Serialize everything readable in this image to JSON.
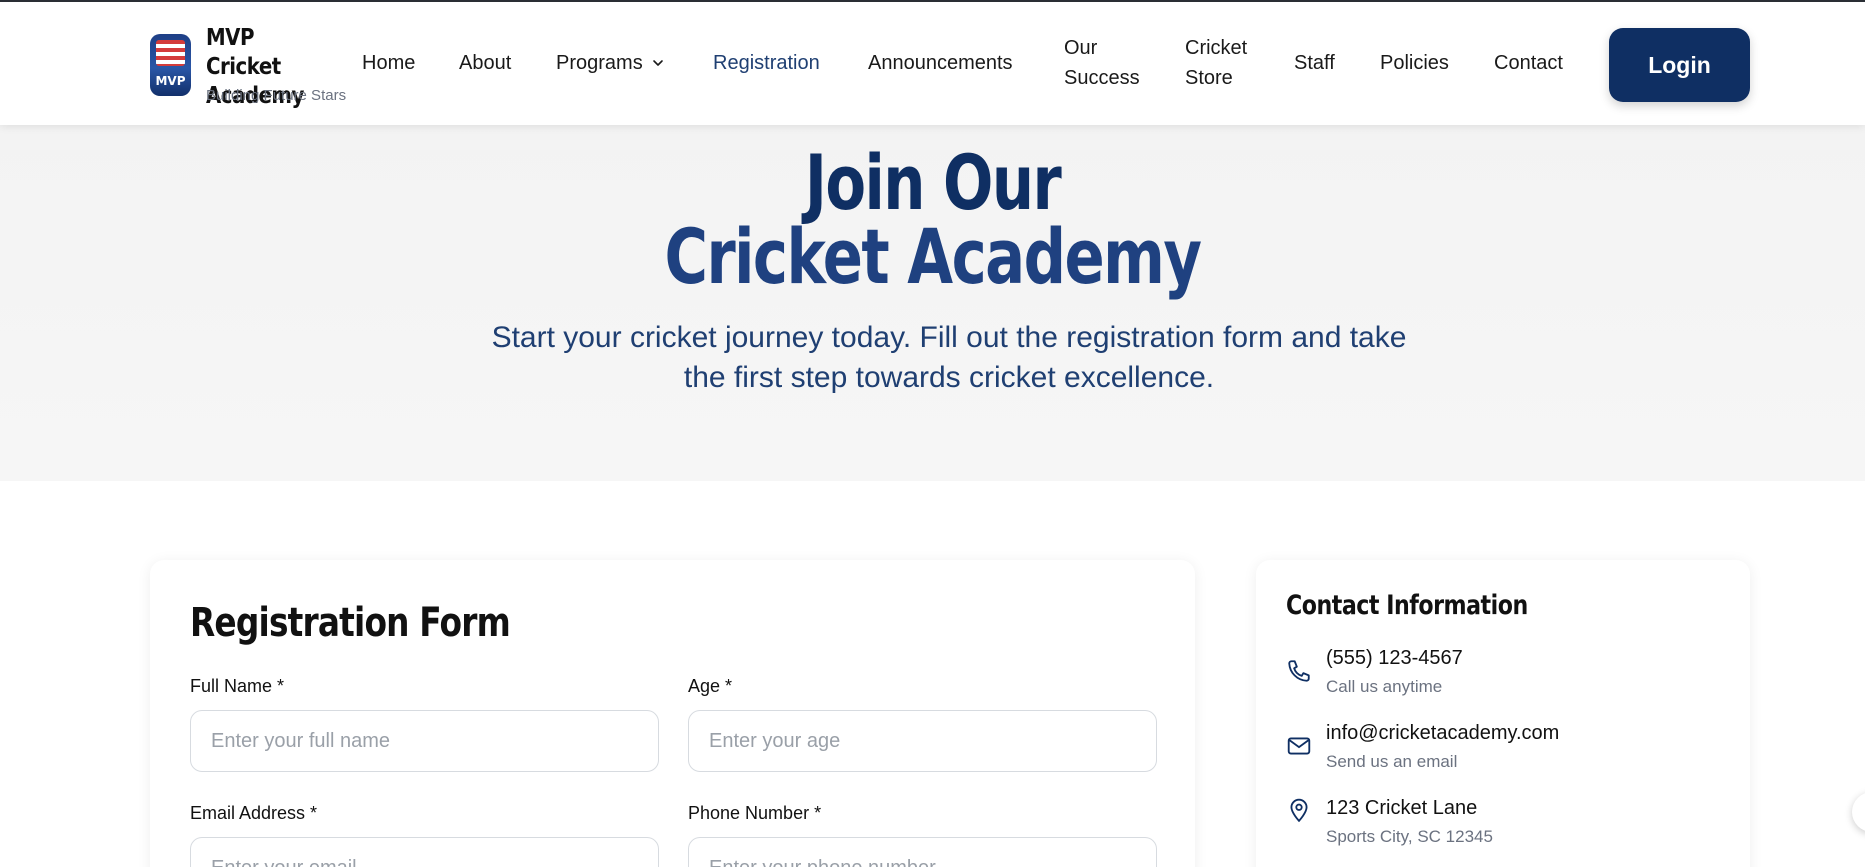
{
  "brand": {
    "logo_text": "MVP",
    "name": "MVP Cricket Academy",
    "tagline": "Building Future Stars"
  },
  "nav": {
    "items": [
      {
        "label": "Home"
      },
      {
        "label": "About"
      },
      {
        "label": "Programs",
        "has_dropdown": true
      },
      {
        "label": "Registration",
        "active": true
      },
      {
        "label": "Announcements"
      },
      {
        "label": "Our Success"
      },
      {
        "label": "Cricket Store"
      },
      {
        "label": "Staff"
      },
      {
        "label": "Policies"
      },
      {
        "label": "Contact"
      }
    ],
    "login_label": "Login"
  },
  "hero": {
    "title_line1": "Join Our",
    "title_line2": "Cricket Academy",
    "subtitle": "Start your cricket journey today. Fill out the registration form and take the first step towards cricket excellence."
  },
  "form": {
    "title": "Registration Form",
    "fields": [
      {
        "label": "Full Name *",
        "placeholder": "Enter your full name",
        "value": ""
      },
      {
        "label": "Age *",
        "placeholder": "Enter your age",
        "value": ""
      },
      {
        "label": "Email Address *",
        "placeholder": "Enter your email",
        "value": ""
      },
      {
        "label": "Phone Number *",
        "placeholder": "Enter your phone number",
        "value": ""
      }
    ]
  },
  "contact": {
    "title": "Contact Information",
    "items": [
      {
        "icon": "phone-icon",
        "main": "(555) 123-4567",
        "sub": "Call us anytime"
      },
      {
        "icon": "mail-icon",
        "main": "info@cricketacademy.com",
        "sub": "Send us an email"
      },
      {
        "icon": "map-pin-icon",
        "main": "123 Cricket Lane",
        "sub": "Sports City, SC 12345"
      }
    ]
  },
  "colors": {
    "primary": "#0f2f63",
    "nav_active": "#1f3f72",
    "muted_text": "#6b7280"
  }
}
